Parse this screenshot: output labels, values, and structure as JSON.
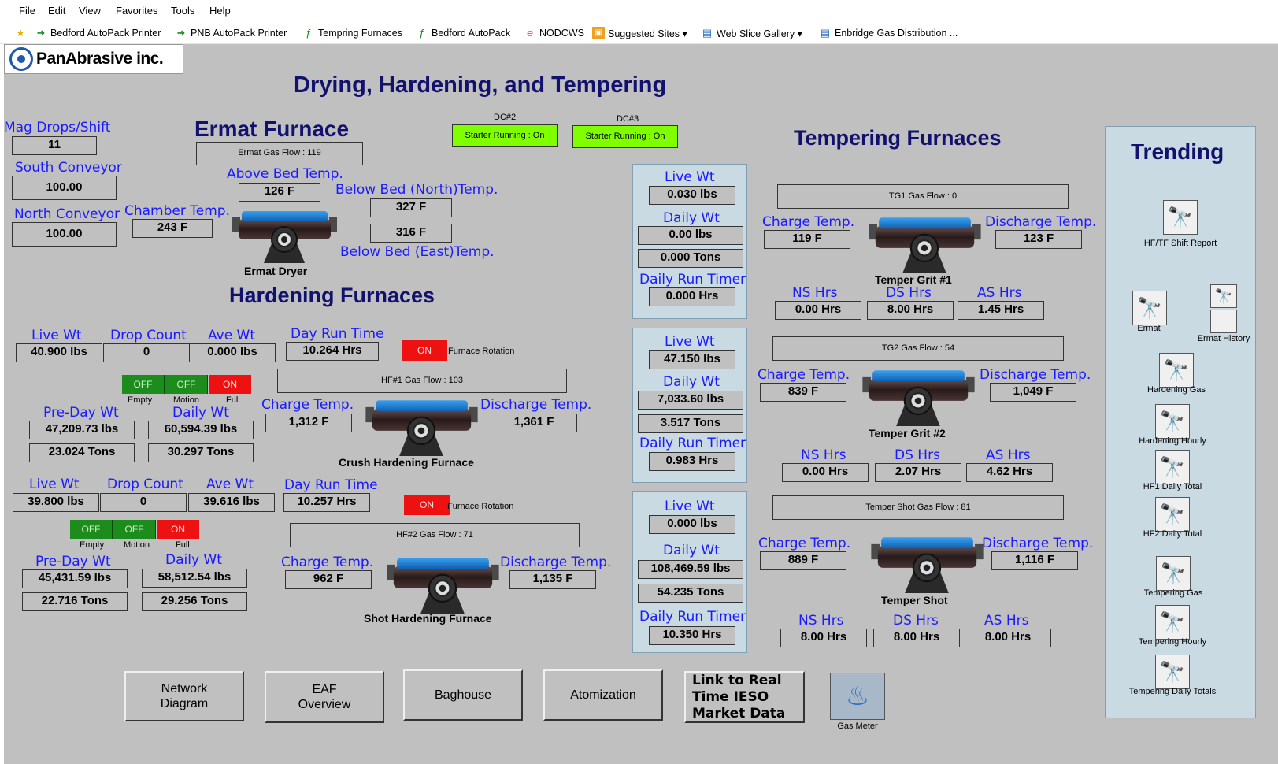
{
  "menu": [
    "File",
    "Edit",
    "View",
    "Favorites",
    "Tools",
    "Help"
  ],
  "favorites": [
    {
      "label": "Bedford AutoPack Printer",
      "icon": "green-arrow-icon"
    },
    {
      "label": "PNB AutoPack Printer",
      "icon": "green-arrow-icon"
    },
    {
      "label": "Tempring Furnaces",
      "icon": "green-link-icon"
    },
    {
      "label": "Bedford AutoPack",
      "icon": "green-link-icon"
    },
    {
      "label": "NODCWS",
      "icon": "red-link-icon"
    },
    {
      "label": "Suggested Sites ▾",
      "icon": "suggested-sites-icon"
    },
    {
      "label": "Web Slice Gallery ▾",
      "icon": "web-slice-icon"
    },
    {
      "label": "Enbridge Gas Distribution ...",
      "icon": "page-icon"
    }
  ],
  "logo": "PanAbrasive inc.",
  "page_title": "Drying, Hardening, and Tempering",
  "ermat": {
    "title": "Ermat Furnace",
    "gas_flow": "Ermat Gas Flow : 119",
    "mag_drops_label": "Mag Drops/Shift",
    "mag_drops": "11",
    "south_conv_label": "South Conveyor",
    "south_conv": "100.00",
    "north_conv_label": "North Conveyor",
    "north_conv": "100.00",
    "chamber_label": "Chamber Temp.",
    "chamber": "243 F",
    "above_bed_label": "Above Bed Temp.",
    "above_bed": "126 F",
    "below_north_label": "Below Bed (North)Temp.",
    "below_north": "327 F",
    "below_east": "316 F",
    "below_east_label": "Below Bed (East)Temp.",
    "dryer_label": "Ermat Dryer"
  },
  "dc": [
    {
      "name": "DC#2",
      "status": "Starter Running : On"
    },
    {
      "name": "DC#3",
      "status": "Starter Running : On"
    }
  ],
  "hardening": {
    "title": "Hardening Furnaces",
    "labels": {
      "live_wt": "Live Wt",
      "drop_count": "Drop Count",
      "ave_wt": "Ave Wt",
      "day_run": "Day Run Time",
      "pre_day": "Pre-Day Wt",
      "daily": "Daily Wt",
      "charge": "Charge Temp.",
      "discharge": "Discharge Temp.",
      "rotation": "Furnace Rotation",
      "empty": "Empty",
      "motion": "Motion",
      "full": "Full",
      "off": "OFF",
      "on": "ON"
    },
    "hf1": {
      "live_wt": "40.900 lbs",
      "drop_count": "0",
      "ave_wt": "0.000 lbs",
      "day_run": "10.264 Hrs",
      "gas_flow": "HF#1 Gas Flow : 103",
      "pre_day_lbs": "47,209.73 lbs",
      "pre_day_tons": "23.024 Tons",
      "daily_lbs": "60,594.39 lbs",
      "daily_tons": "30.297 Tons",
      "charge": "1,312 F",
      "discharge": "1,361 F",
      "name": "Crush Hardening Furnace"
    },
    "hf2": {
      "live_wt": "39.800 lbs",
      "drop_count": "0",
      "ave_wt": "39.616 lbs",
      "day_run": "10.257 Hrs",
      "gas_flow": "HF#2 Gas Flow : 71",
      "pre_day_lbs": "45,431.59 lbs",
      "pre_day_tons": "22.716 Tons",
      "daily_lbs": "58,512.54 lbs",
      "daily_tons": "29.256 Tons",
      "charge": "962 F",
      "discharge": "1,135 F",
      "name": "Shot Hardening Furnace"
    }
  },
  "scale_labels": {
    "live_wt": "Live Wt",
    "daily_wt": "Daily Wt",
    "daily_run": "Daily Run Timer"
  },
  "scales": [
    {
      "live_wt": "0.030 lbs",
      "daily_wt": "0.00 lbs",
      "tons": "0.000 Tons",
      "timer": "0.000 Hrs"
    },
    {
      "live_wt": "47.150 lbs",
      "daily_wt": "7,033.60 lbs",
      "tons": "3.517 Tons",
      "timer": "0.983 Hrs"
    },
    {
      "live_wt": "0.000 lbs",
      "daily_wt": "108,469.59 lbs",
      "tons": "54.235 Tons",
      "timer": "10.350 Hrs"
    }
  ],
  "tempering": {
    "title": "Tempering Furnaces",
    "labels": {
      "charge": "Charge Temp.",
      "discharge": "Discharge Temp.",
      "ns": "NS Hrs",
      "ds": "DS Hrs",
      "as": "AS Hrs"
    },
    "tg1": {
      "gas_flow": "TG1 Gas Flow : 0",
      "charge": "119 F",
      "discharge": "123 F",
      "name": "Temper Grit #1",
      "ns": "0.00 Hrs",
      "ds": "8.00 Hrs",
      "as": "1.45 Hrs"
    },
    "tg2": {
      "gas_flow": "TG2 Gas Flow : 54",
      "charge": "839 F",
      "discharge": "1,049 F",
      "name": "Temper Grit #2",
      "ns": "0.00 Hrs",
      "ds": "2.07 Hrs",
      "as": "4.62 Hrs"
    },
    "ts": {
      "gas_flow": "Temper Shot Gas Flow : 81",
      "charge": "889 F",
      "discharge": "1,116 F",
      "name": "Temper Shot",
      "ns": "8.00 Hrs",
      "ds": "8.00 Hrs",
      "as": "8.00 Hrs"
    }
  },
  "trending": {
    "title": "Trending",
    "items": [
      "HF/TF Shift Report",
      "Ermat",
      "Ermat History",
      "Hardening Gas",
      "Hardening Hourly",
      "HF1 Daily Total",
      "HF2 Daily Total",
      "Tempering Gas",
      "Tempering Hourly",
      "Tempering Daily Totals"
    ]
  },
  "nav_buttons": {
    "network": "Network Diagram",
    "eaf": "EAF Overview",
    "baghouse": "Baghouse",
    "atomization": "Atomization",
    "ieso": "Link to Real Time IESO Market Data",
    "gas_meter": "Gas Meter"
  },
  "colors": {
    "label_blue": "#1a1aff",
    "title_navy": "#12126e",
    "hmi_bg": "#c0c0c0",
    "panel_blue": "#c9dae3",
    "running_green": "#7fff00",
    "off_green": "#1c8c1c",
    "on_red": "#ee1111"
  }
}
